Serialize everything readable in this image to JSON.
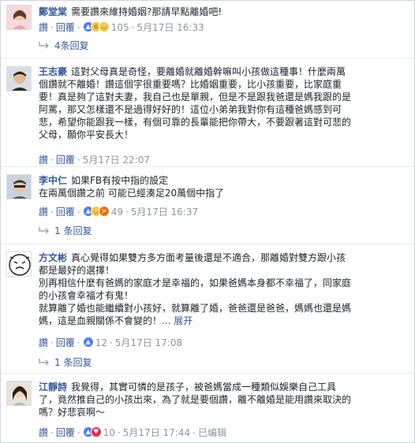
{
  "actions": {
    "like": "讚",
    "reply": "回覆"
  },
  "comments": [
    {
      "name": "鄭堂棠",
      "lines": [
        "需要讚來維持婚姻?那請早點離婚吧!"
      ],
      "reactions": [
        "like",
        "wow",
        "haha"
      ],
      "count": "105",
      "time": "5月17日 16:33",
      "replies": "4条回复",
      "edited": ""
    },
    {
      "name": "王志豪",
      "lines": [
        "這對父母真是奇怪，要離婚就離婚幹嘛叫小孩做這種事！什麼兩萬",
        "個讚就不離婚！讚這個字很重要嗎？比婚姻重要，比小孩重要，比家庭重",
        "要！真是夠了這對夫妻，我自己也是單親，但是不是跟我爸還是媽我跟的是",
        "阿罵，那又怎樣還不是過得好好的！這位小弟弟我對你有這種爸媽感到可",
        "悲，希望你能跟我一樣，有個可靠的長輩能把你帶大，不要跟著這對可悲的",
        "父母，願你平安長大！"
      ],
      "time": "5月17日 22:07"
    },
    {
      "name": "李中仁",
      "lines": [
        "如果FB有按中指的設定",
        "在兩萬個讚之前 可能已經湊足20萬個中指了"
      ],
      "reactions": [
        "like",
        "haha",
        "angry"
      ],
      "count": "49",
      "time": "5月17日 16:37",
      "replies": "1 条回复"
    },
    {
      "name": "方文彬",
      "lines": [
        "真心覺得如果雙方多方面考量後還是不適合，那離婚對雙方跟小孩",
        "都是最好的選擇！",
        "別再相信什麼有爸媽的家庭才是幸福的，如果爸媽本身都不幸福了，同家庭",
        "的小孩會幸福才有鬼！",
        "就算離了婚也能繼續對小孩好，就算離了婚，爸爸還是爸爸，媽媽也還是媽",
        "媽，這是血親關係不會變的！"
      ],
      "more": "... 展开",
      "reactions": [
        "like"
      ],
      "count": "12",
      "time": "5月17日 17:08",
      "replies": "1 条回复"
    },
    {
      "name": "江靜詩",
      "lines": [
        "我覺得，其實可憐的是孩子，被爸媽當成一種類似娛樂自己工具",
        "了，竟然推自己的小孩出來，為了就是要個讚，離不離婚是能用讚來取決的",
        "嗎？好悲哀啊～"
      ],
      "reactions": [
        "like",
        "love"
      ],
      "count": "10",
      "time": "5月17日 17:44",
      "edited": "已编辑"
    }
  ],
  "colors": {
    "link": "#365899",
    "meta": "#90949c",
    "text": "#1d2129"
  },
  "icons": {
    "reply_arrow": "reply-arrow-icon",
    "like": "like-reaction-icon",
    "wow": "wow-reaction-icon",
    "haha": "haha-reaction-icon",
    "angry": "angry-reaction-icon",
    "love": "love-reaction-icon"
  }
}
